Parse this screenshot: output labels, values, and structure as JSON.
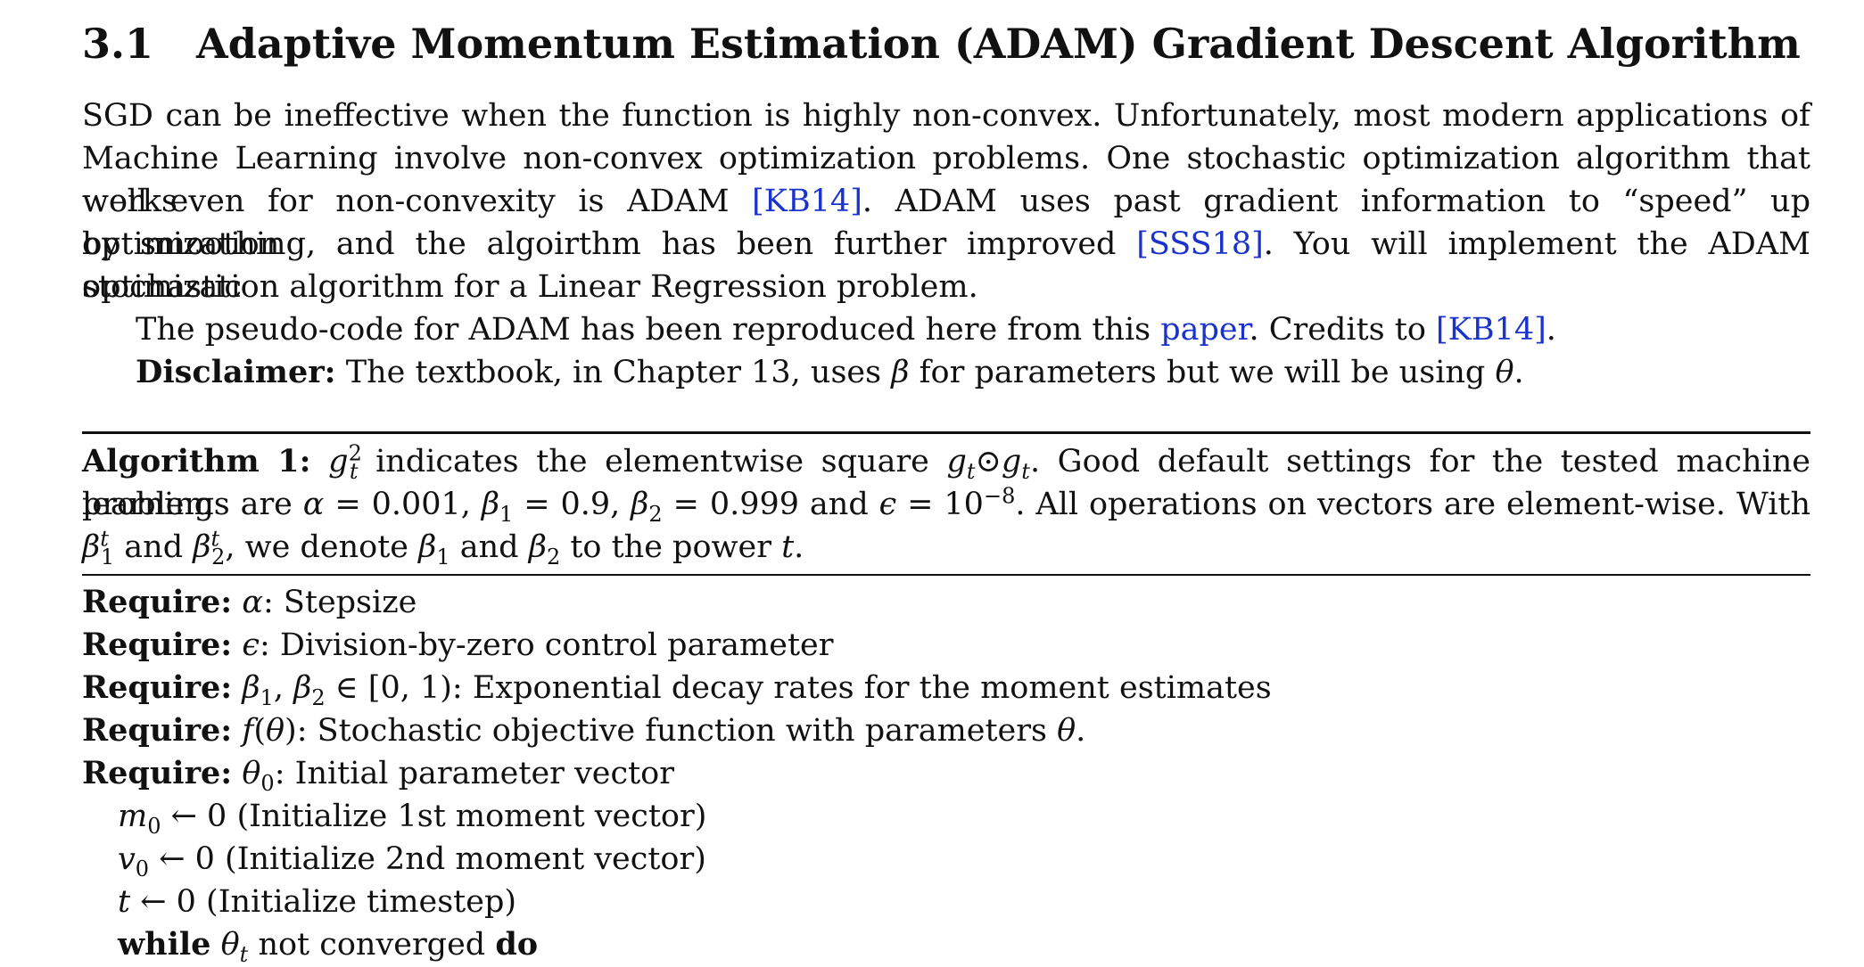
{
  "section": {
    "number": "3.1",
    "title": "Adaptive Momentum Estimation (ADAM) Gradient Descent Algorithm"
  },
  "intro": {
    "line1": "SGD can be ineffective when the function is highly non-convex. Unfortunately, most modern applications of",
    "line2": "Machine Learning involve non-convex optimization problems. One stochastic optimization algorithm that works",
    "line3_pre": "well even for non-convexity is ADAM ",
    "line3_cite": "[KB14]",
    "line3_post": ". ADAM uses past gradient information to “speed” up optimization",
    "line4_pre": "by smoothing, and the algoirthm has been further improved ",
    "line4_cite": "[SSS18]",
    "line4_post": ". You will implement the ADAM stochastic",
    "line5": "optimization algorithm for a Linear Regression problem.",
    "pseudo_pre": "The pseudo-code for ADAM has been reproduced here from this ",
    "pseudo_link": "paper",
    "pseudo_mid": ". Credits to ",
    "pseudo_cite": "[KB14]",
    "pseudo_post": ".",
    "disclaimer_label": "Disclaimer:",
    "disclaimer_text_1": " The textbook, in Chapter 13, uses ",
    "disclaimer_beta": "β",
    "disclaimer_text_2": " for parameters but we will be using ",
    "disclaimer_theta": "θ",
    "disclaimer_text_3": "."
  },
  "algorithm": {
    "label": "Algorithm 1:",
    "cap1_a": " ",
    "cap1_g": "g",
    "cap1_sup": "2",
    "cap1_sub": "t",
    "cap1_b": " indicates the elementwise square ",
    "cap1_c": "g",
    "cap1_c_sub": "t",
    "cap1_odot": "⊙",
    "cap1_d": "g",
    "cap1_d_sub": "t",
    "cap1_e": ". Good default settings for the tested machine learning",
    "cap2_a": "problems are ",
    "cap2_alpha": "α",
    "cap2_b": " = 0.001, ",
    "cap2_beta1": "β",
    "cap2_beta1_sub": "1",
    "cap2_c": " = 0.9, ",
    "cap2_beta2": "β",
    "cap2_beta2_sub": "2",
    "cap2_d": " = 0.999 and ",
    "cap2_eps": "ϵ",
    "cap2_e": " = 10",
    "cap2_exp": "−8",
    "cap2_f": ". All operations on vectors are element-wise. With",
    "cap3_beta1": "β",
    "cap3_beta1_sup": "t",
    "cap3_beta1_sub": "1",
    "cap3_a": " and ",
    "cap3_beta2": "β",
    "cap3_beta2_sup": "t",
    "cap3_beta2_sub": "2",
    "cap3_b": ", we denote ",
    "cap3_c": "β",
    "cap3_c_sub": "1",
    "cap3_d": " and ",
    "cap3_e": "β",
    "cap3_e_sub": "2",
    "cap3_f": " to the power ",
    "cap3_t": "t",
    "cap3_g": ".",
    "require_label": "Require:",
    "req1_sym": "α",
    "req1_text": ": Stepsize",
    "req2_sym": "ϵ",
    "req2_text": ": Division-by-zero control parameter",
    "req3_b1": "β",
    "req3_b1_sub": "1",
    "req3_comma": ", ",
    "req3_b2": "β",
    "req3_b2_sub": "2",
    "req3_text": " ∈ [0, 1): Exponential decay rates for the moment estimates",
    "req4_f": "f",
    "req4_paren": "(",
    "req4_theta": "θ",
    "req4_text": "): Stochastic objective function with parameters ",
    "req4_theta2": "θ",
    "req4_end": ".",
    "req5_theta": "θ",
    "req5_sub": "0",
    "req5_text": ": Initial parameter vector",
    "s1_var": "m",
    "s1_sub": "0",
    "s1_text": " ← 0 (Initialize 1st moment vector)",
    "s2_var": "v",
    "s2_sub": "0",
    "s2_text": " ← 0 (Initialize 2nd moment vector)",
    "s3_var": "t",
    "s3_text": " ← 0 (Initialize timestep)",
    "while_kw": "while",
    "while_theta": "θ",
    "while_sub": "t",
    "while_text": " not converged ",
    "do_kw": "do"
  }
}
